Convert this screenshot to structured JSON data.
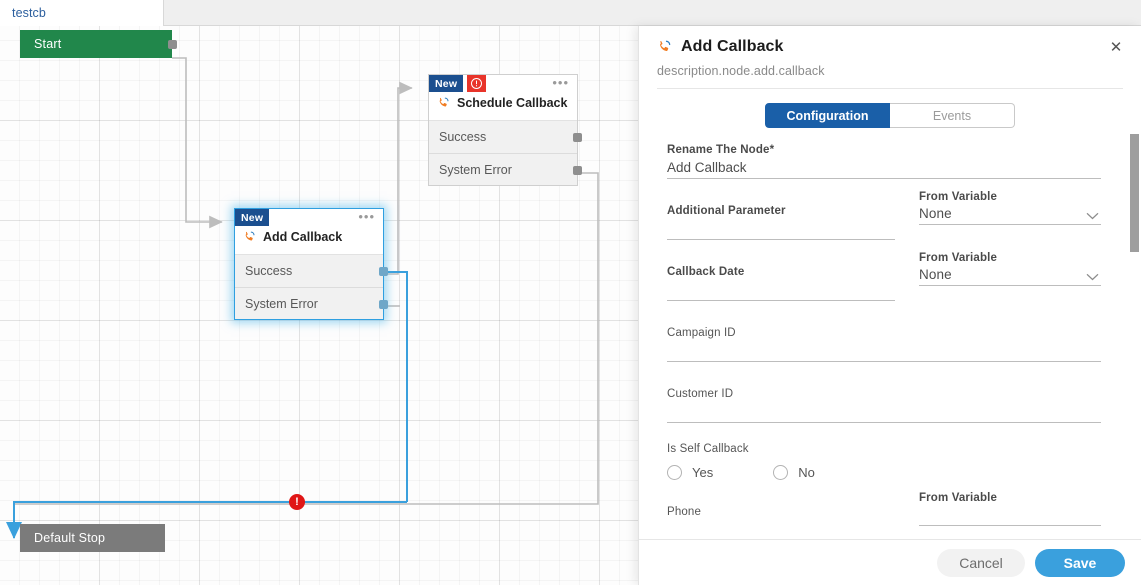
{
  "tabstrip": {
    "tabs": [
      {
        "label": "testcb"
      }
    ]
  },
  "canvas": {
    "nodes": [
      {
        "id": "start",
        "label": "Start",
        "type": "pill"
      },
      {
        "id": "schedule-callback",
        "badge": "New",
        "has_error": true,
        "title": "Schedule Callback",
        "icon": "phone-callback-icon",
        "ports": [
          "Success",
          "System Error"
        ],
        "selected": false
      },
      {
        "id": "add-callback",
        "badge": "New",
        "has_error": false,
        "title": "Add Callback",
        "icon": "phone-callback-icon",
        "ports": [
          "Success",
          "System Error"
        ],
        "selected": true
      },
      {
        "id": "default-stop",
        "label": "Default Stop",
        "type": "pill"
      }
    ],
    "edge_error_marker": "!",
    "colors": {
      "start_green": "#21874b",
      "stop_gray": "#7b7b7b",
      "selected_blue": "#2f9fe0",
      "edge_gray": "#bdbdbd",
      "edge_blue": "#3aa0dd",
      "error_red": "#e01616",
      "badge_blue": "#1b4f8f"
    }
  },
  "drawer": {
    "title": "Add Callback",
    "title_icon": "phone-callback-icon",
    "subtitle": "description.node.add.callback",
    "close_icon": "close-icon",
    "tabs": [
      {
        "label": "Configuration",
        "active": true
      },
      {
        "label": "Events",
        "active": false
      }
    ],
    "fields": {
      "rename": {
        "label": "Rename The Node*",
        "value": "Add Callback",
        "placeholder": ""
      },
      "additional_parameter": {
        "label": "Additional Parameter",
        "value": "",
        "placeholder": ""
      },
      "additional_parameter_var": {
        "label": "From Variable",
        "value": "None"
      },
      "callback_date": {
        "label": "Callback Date",
        "value": "",
        "placeholder": ""
      },
      "callback_date_var": {
        "label": "From Variable",
        "value": "None"
      },
      "campaign_id": {
        "label": "Campaign ID",
        "value": "",
        "placeholder": ""
      },
      "customer_id": {
        "label": "Customer ID",
        "value": "",
        "placeholder": ""
      },
      "is_self_callback": {
        "label": "Is Self Callback",
        "options": [
          {
            "label": "Yes",
            "selected": false
          },
          {
            "label": "No",
            "selected": false
          }
        ]
      },
      "phone": {
        "label": "Phone",
        "value": "",
        "placeholder": ""
      },
      "phone_var": {
        "label": "From Variable",
        "value": ""
      }
    },
    "footer": {
      "cancel_label": "Cancel",
      "save_label": "Save"
    },
    "accent": "#1a5fa8",
    "save_color": "#3aa0dd"
  }
}
